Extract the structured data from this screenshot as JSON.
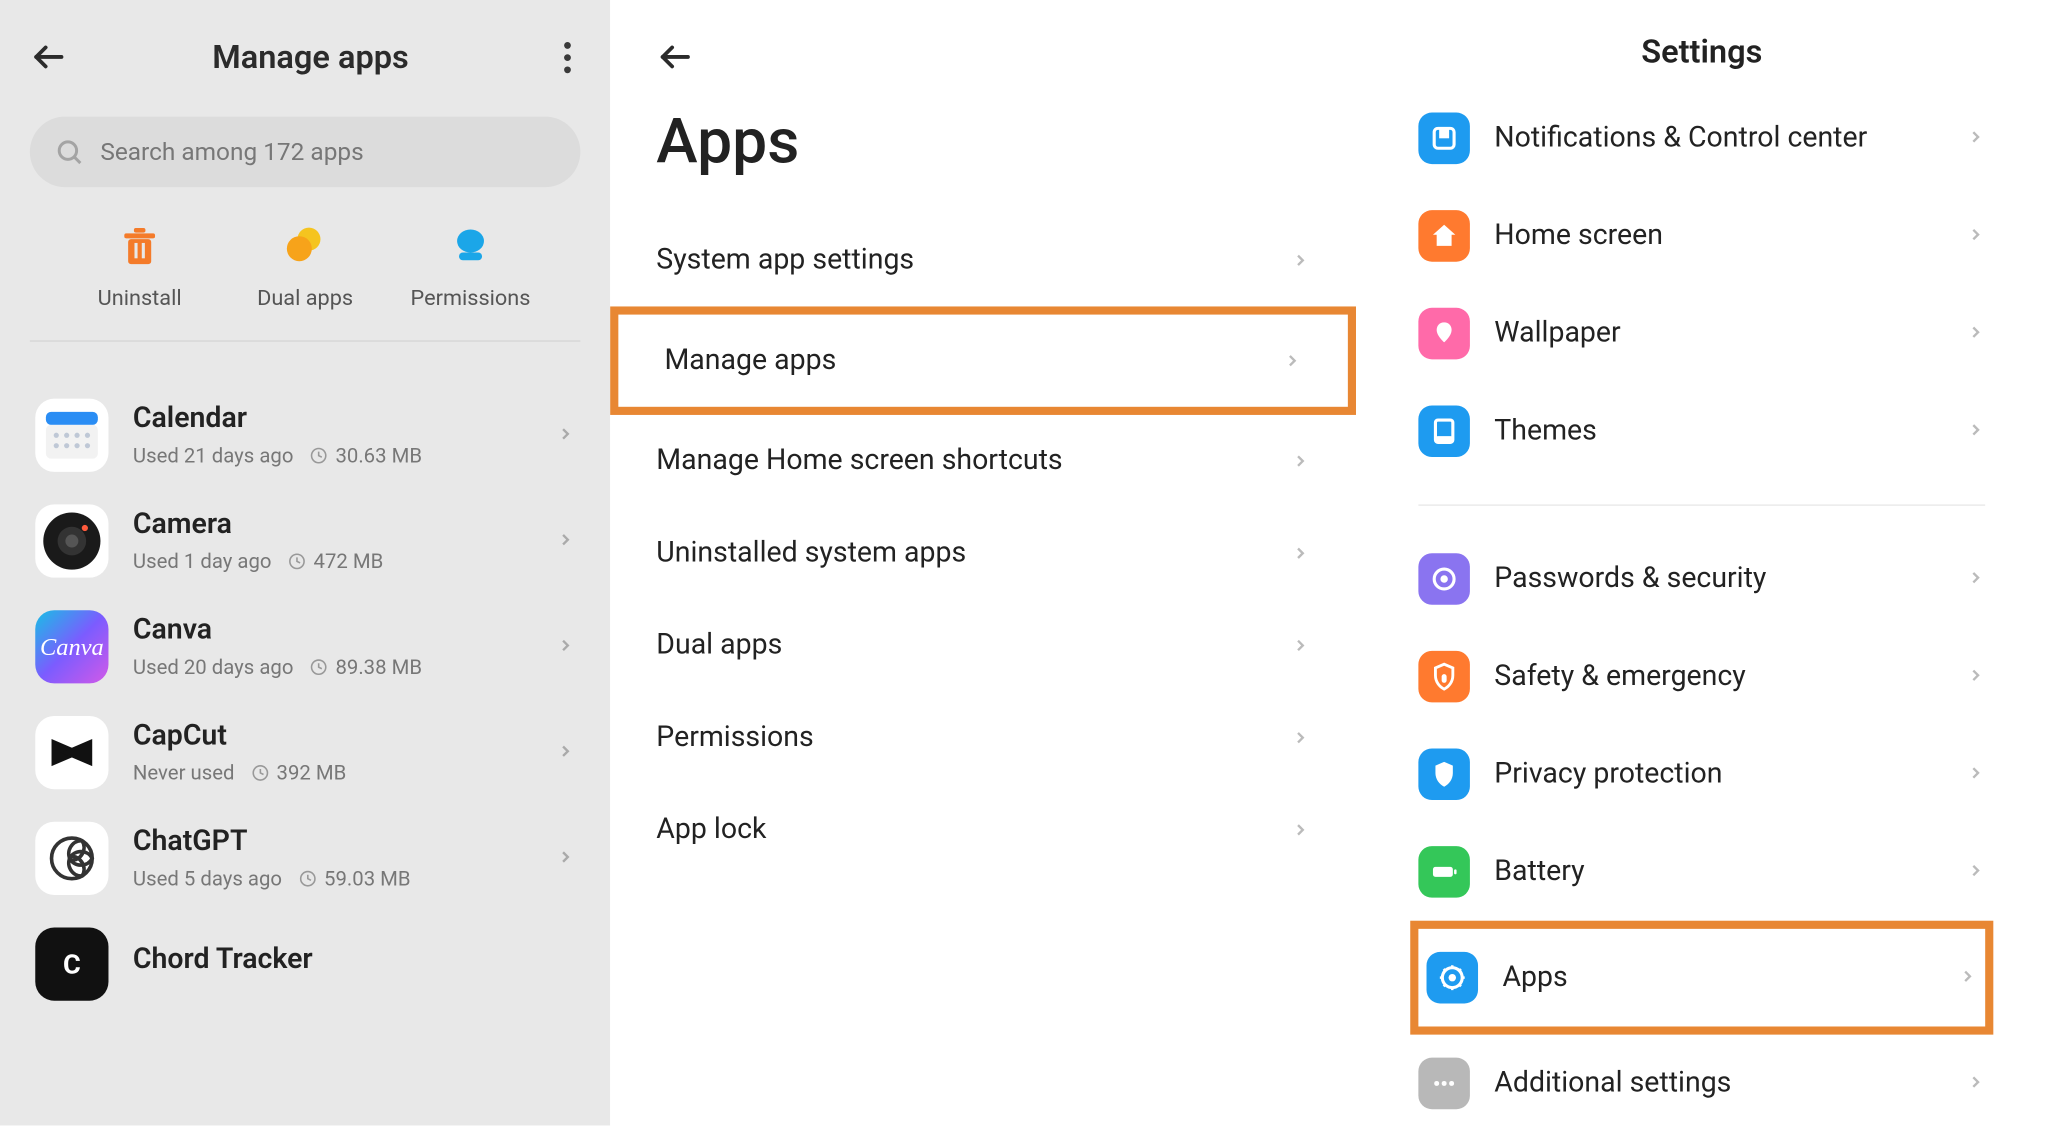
{
  "pane1": {
    "title": "Manage apps",
    "search_placeholder": "Search among 172 apps",
    "actions": [
      {
        "label": "Uninstall"
      },
      {
        "label": "Dual apps"
      },
      {
        "label": "Permissions"
      }
    ],
    "apps": [
      {
        "name": "Calendar",
        "used": "Used 21 days ago",
        "size": "30.63 MB"
      },
      {
        "name": "Camera",
        "used": "Used 1 day ago",
        "size": "472 MB"
      },
      {
        "name": "Canva",
        "used": "Used 20 days ago",
        "size": "89.38 MB"
      },
      {
        "name": "CapCut",
        "used": "Never used",
        "size": "392 MB"
      },
      {
        "name": "ChatGPT",
        "used": "Used 5 days ago",
        "size": "59.03 MB"
      },
      {
        "name": "Chord Tracker",
        "used": "",
        "size": ""
      }
    ]
  },
  "pane2": {
    "title": "Apps",
    "items": [
      {
        "label": "System app settings"
      },
      {
        "label": "Manage apps",
        "highlighted": true
      },
      {
        "label": "Manage Home screen shortcuts"
      },
      {
        "label": "Uninstalled system apps"
      },
      {
        "label": "Dual apps"
      },
      {
        "label": "Permissions"
      },
      {
        "label": "App lock"
      }
    ]
  },
  "pane3": {
    "title": "Settings",
    "items": [
      {
        "label": "Notifications & Control center",
        "icon": "notifications",
        "color": "#1e9bf0"
      },
      {
        "label": "Home screen",
        "icon": "home",
        "color": "#ff7a2f"
      },
      {
        "label": "Wallpaper",
        "icon": "wallpaper",
        "color": "#ff6aa9"
      },
      {
        "label": "Themes",
        "icon": "themes",
        "color": "#1e9bf0"
      },
      {
        "sep": true
      },
      {
        "label": "Passwords & security",
        "icon": "lock",
        "color": "#8a74f0"
      },
      {
        "label": "Safety & emergency",
        "icon": "safety",
        "color": "#ff7a2f"
      },
      {
        "label": "Privacy protection",
        "icon": "privacy",
        "color": "#1e9bf0"
      },
      {
        "label": "Battery",
        "icon": "battery",
        "color": "#34c759"
      },
      {
        "label": "Apps",
        "icon": "apps",
        "color": "#1e9bf0",
        "highlighted": true
      },
      {
        "label": "Additional settings",
        "icon": "more",
        "color": "#b8b8b8"
      }
    ]
  }
}
